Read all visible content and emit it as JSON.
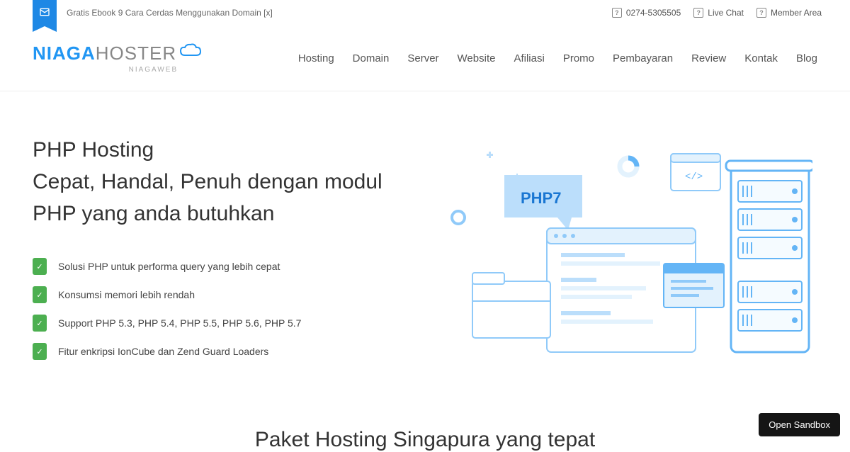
{
  "topbar": {
    "promo_text": "Gratis Ebook 9 Cara Cerdas Menggunakan Domain [x]",
    "phone": "0274-5305505",
    "live_chat": "Live Chat",
    "member_area": "Member Area"
  },
  "logo": {
    "part1": "NIAGA",
    "part2": "HOSTER",
    "sub": "NIAGAWEB"
  },
  "nav": [
    "Hosting",
    "Domain",
    "Server",
    "Website",
    "Afiliasi",
    "Promo",
    "Pembayaran",
    "Review",
    "Kontak",
    "Blog"
  ],
  "hero": {
    "title_line1": "PHP Hosting",
    "title_line2": "Cepat, Handal, Penuh dengan modul PHP yang anda butuhkan"
  },
  "features": [
    "Solusi PHP untuk performa query yang lebih cepat",
    "Konsumsi memori lebih rendah",
    "Support PHP 5.3, PHP 5.4, PHP 5.5, PHP 5.6, PHP 5.7",
    "Fitur enkripsi IonCube dan Zend Guard Loaders"
  ],
  "illustration": {
    "php_label": "PHP7"
  },
  "section_title": "Paket Hosting Singapura yang tepat",
  "sandbox_button": "Open Sandbox"
}
